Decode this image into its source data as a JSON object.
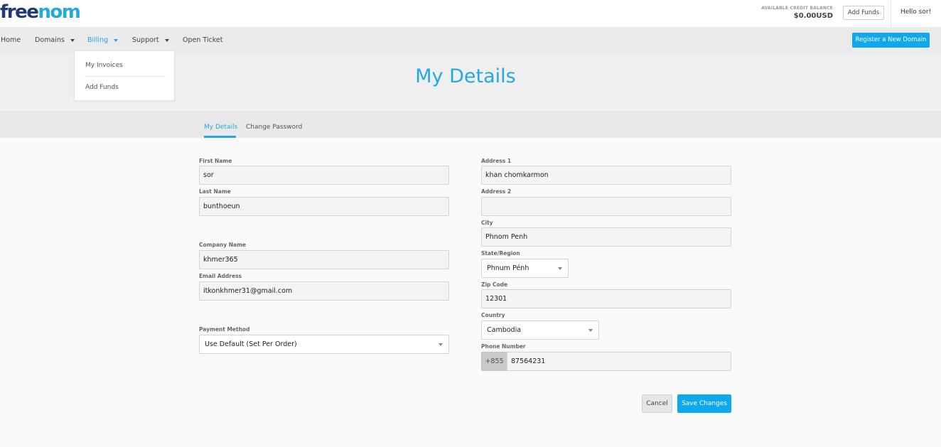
{
  "brand": {
    "logo_part1": "free",
    "logo_part2": "nom"
  },
  "account": {
    "credit_label": "AVAILABLE CREDIT BALANCE",
    "credit_value": "$0.00USD",
    "add_funds_label": "Add Funds",
    "greeting": "Hello sor!"
  },
  "nav": {
    "home": "Home",
    "domains": "Domains",
    "billing": "Billing",
    "support": "Support",
    "open_ticket": "Open Ticket",
    "register_button": "Register a New Domain"
  },
  "billing_dropdown": {
    "items": [
      "My Invoices",
      "Add Funds"
    ]
  },
  "page": {
    "title": "My Details"
  },
  "tabs": {
    "my_details": "My Details",
    "change_password": "Change Password"
  },
  "form": {
    "first_name": {
      "label": "First Name",
      "value": "sor"
    },
    "last_name": {
      "label": "Last Name",
      "value": "bunthoeun"
    },
    "company_name": {
      "label": "Company Name",
      "value": "khmer365"
    },
    "email": {
      "label": "Email Address",
      "value": "itkonkhmer31@gmail.com"
    },
    "payment_method": {
      "label": "Payment Method",
      "value": "Use Default (Set Per Order)"
    },
    "address1": {
      "label": "Address 1",
      "value": "khan chomkarmon"
    },
    "address2": {
      "label": "Address 2",
      "value": ""
    },
    "city": {
      "label": "City",
      "value": "Phnom Penh"
    },
    "state": {
      "label": "State/Region",
      "value": "Phnum Pénh"
    },
    "zip": {
      "label": "Zip Code",
      "value": "12301"
    },
    "country": {
      "label": "Country",
      "value": "Cambodia"
    },
    "phone": {
      "label": "Phone Number",
      "prefix": "+855",
      "value": "87564231"
    },
    "cancel_label": "Cancel",
    "save_label": "Save Changes"
  },
  "colors": {
    "accent": "#23a8e0",
    "brand_dark": "#1f3a78",
    "button_blue": "#0fa8ec"
  }
}
